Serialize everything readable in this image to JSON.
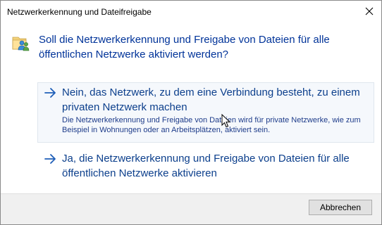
{
  "window": {
    "title": "Netzwerkerkennung und Dateifreigabe",
    "close_icon": "close-icon"
  },
  "header": {
    "icon": "network-sharing-icon",
    "question": "Soll die Netzwerkerkennung und Freigabe von Dateien für alle öffentlichen Netzwerke aktiviert werden?"
  },
  "options": [
    {
      "icon": "arrow-right-icon",
      "label": "Nein, das Netzwerk, zu dem eine Verbindung besteht, zu einem privaten Netzwerk machen",
      "description": "Die Netzwerkerkennung und Freigabe von Dateien wird für private Netzwerke, wie zum Beispiel in Wohnungen oder an Arbeitsplätzen, aktiviert sein."
    },
    {
      "icon": "arrow-right-icon",
      "label": "Ja, die Netzwerkerkennung und Freigabe von Dateien für alle öffentlichen Netzwerke aktivieren"
    }
  ],
  "footer": {
    "cancel_label": "Abbrechen"
  },
  "colors": {
    "accent": "#003399",
    "link": "#0c3f8c",
    "footer_bg": "#f0f0f0"
  }
}
